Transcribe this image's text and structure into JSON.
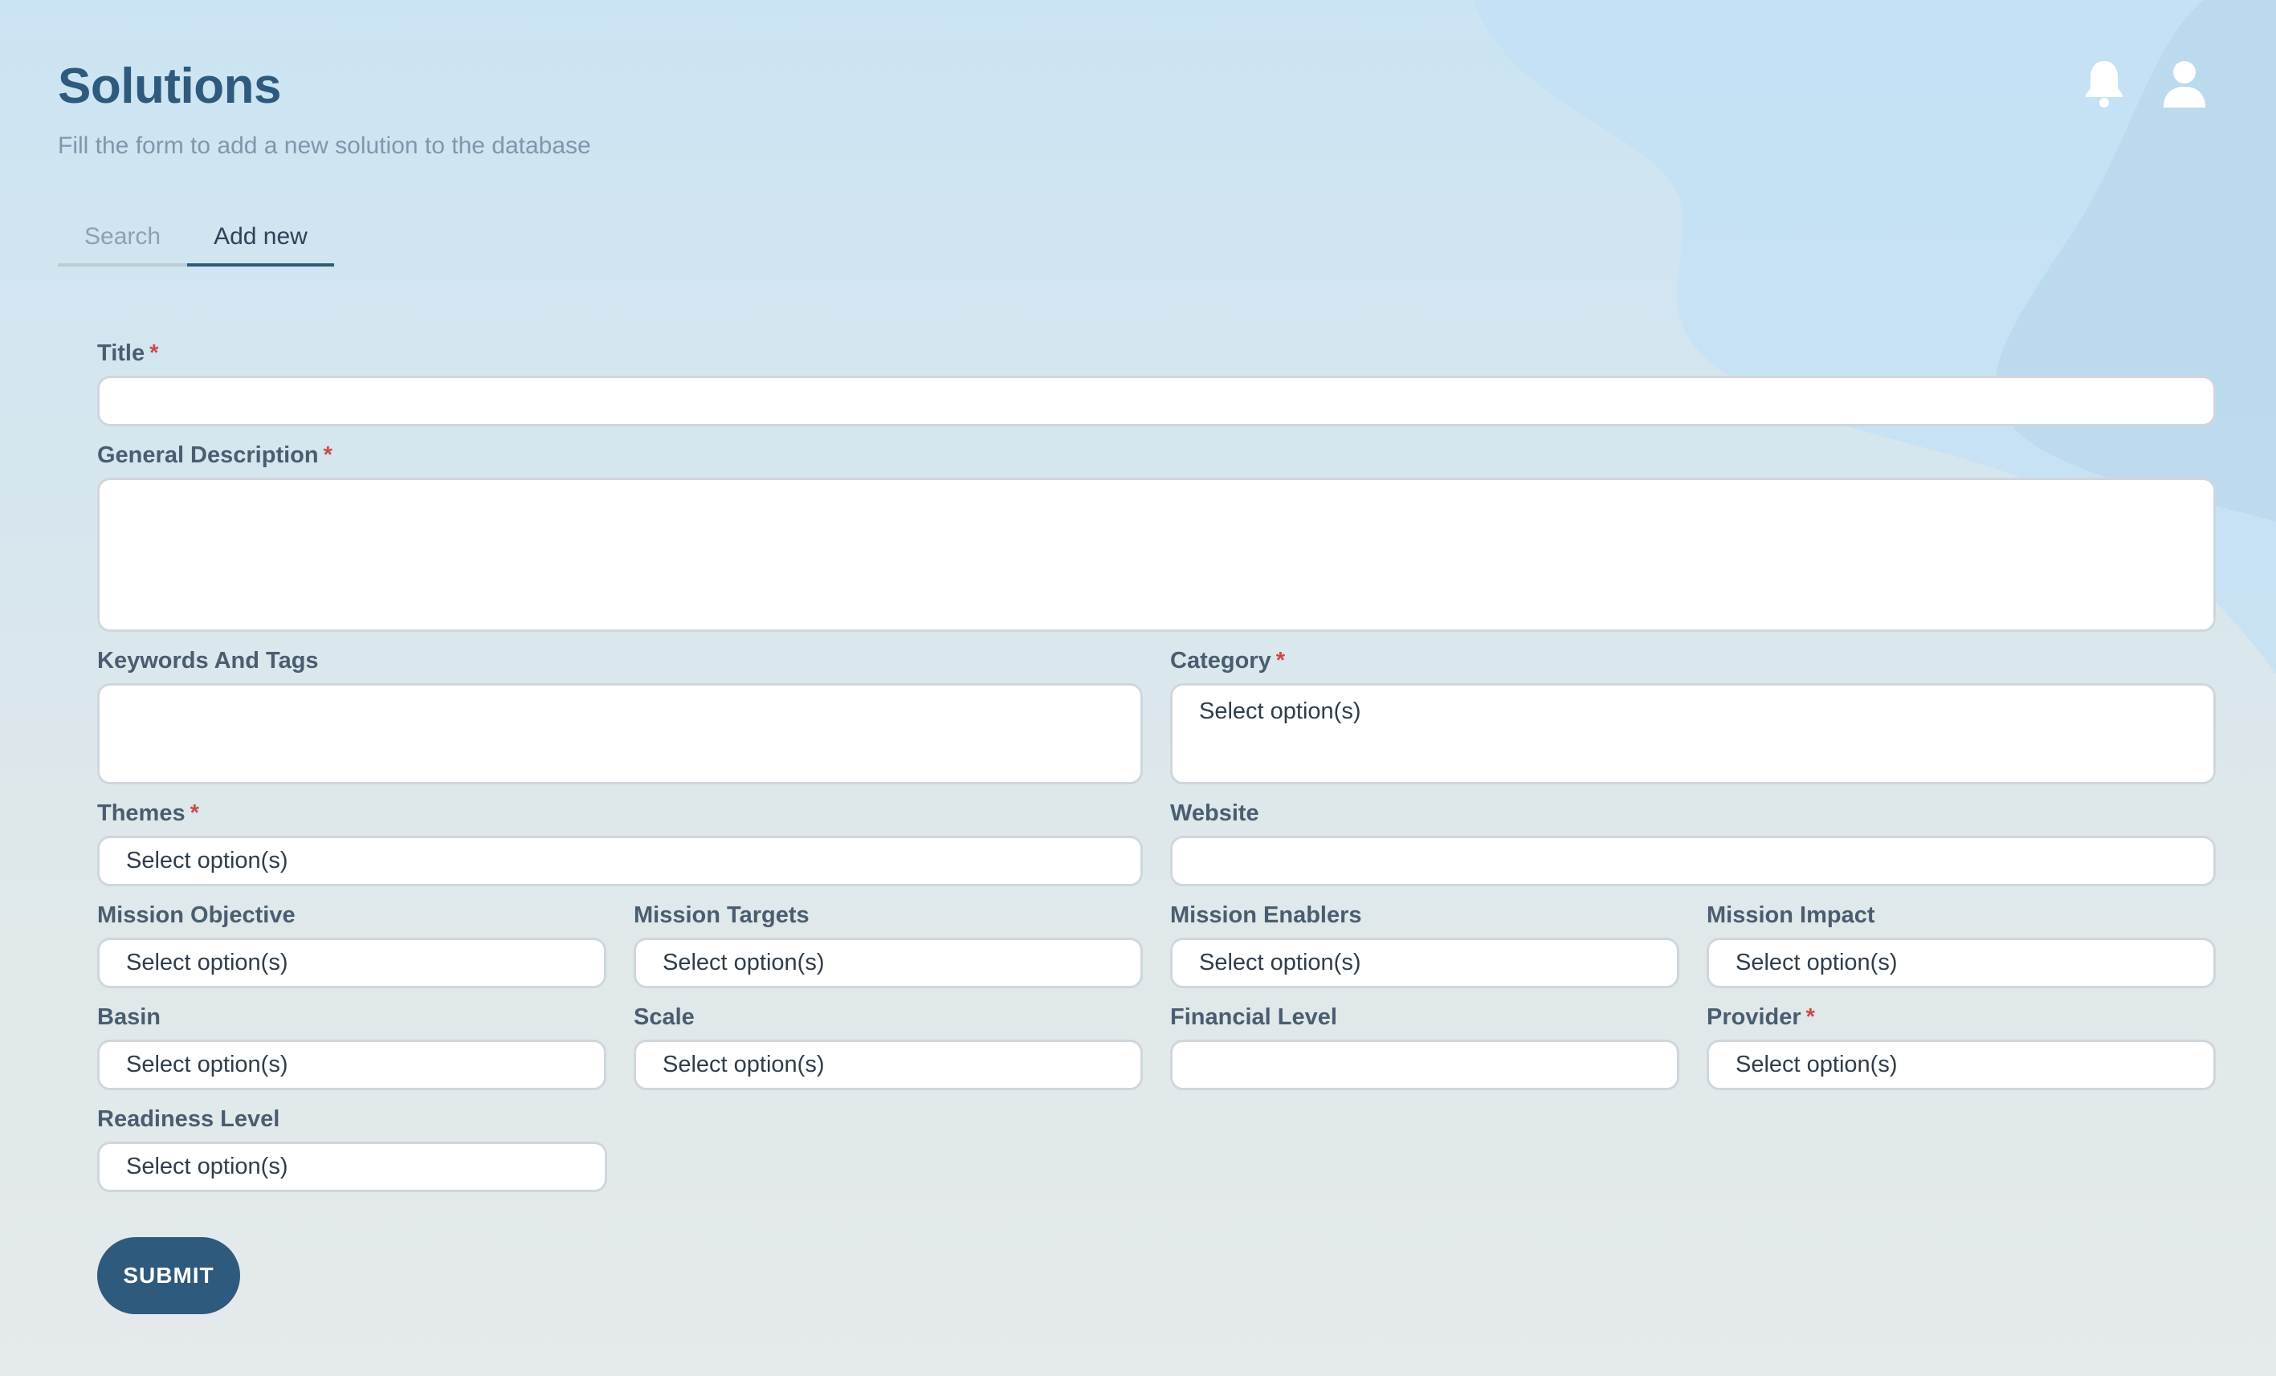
{
  "header": {
    "title": "Solutions",
    "subtitle": "Fill the form to add a new solution to the database",
    "icons": [
      "bell-icon",
      "user-icon"
    ]
  },
  "tabs": [
    {
      "label": "Search",
      "active": false
    },
    {
      "label": "Add new",
      "active": true
    }
  ],
  "form": {
    "title": {
      "label": "Title",
      "required": "*",
      "value": ""
    },
    "general_description": {
      "label": "General Description",
      "required": "*",
      "value": ""
    },
    "keywords_and_tags": {
      "label": "Keywords And Tags",
      "value": ""
    },
    "category": {
      "label": "Category",
      "required": "*",
      "placeholder": "Select option(s)"
    },
    "themes": {
      "label": "Themes",
      "required": "*",
      "placeholder": "Select option(s)"
    },
    "website": {
      "label": "Website",
      "value": ""
    },
    "mission_objective": {
      "label": "Mission Objective",
      "placeholder": "Select option(s)"
    },
    "mission_targets": {
      "label": "Mission Targets",
      "placeholder": "Select option(s)"
    },
    "mission_enablers": {
      "label": "Mission Enablers",
      "placeholder": "Select option(s)"
    },
    "mission_impact": {
      "label": "Mission Impact",
      "placeholder": "Select option(s)"
    },
    "basin": {
      "label": "Basin",
      "placeholder": "Select option(s)"
    },
    "scale": {
      "label": "Scale",
      "placeholder": "Select option(s)"
    },
    "financial_level": {
      "label": "Financial Level",
      "value": ""
    },
    "provider": {
      "label": "Provider",
      "required": "*",
      "placeholder": "Select option(s)"
    },
    "readiness_level": {
      "label": "Readiness Level",
      "placeholder": "Select option(s)"
    },
    "submit_label": "SUBMIT"
  },
  "colors": {
    "primary": "#2e5a7d",
    "required": "#c94a4a",
    "background_top": "#cbe4f3",
    "background_bottom": "#e5eaec"
  }
}
